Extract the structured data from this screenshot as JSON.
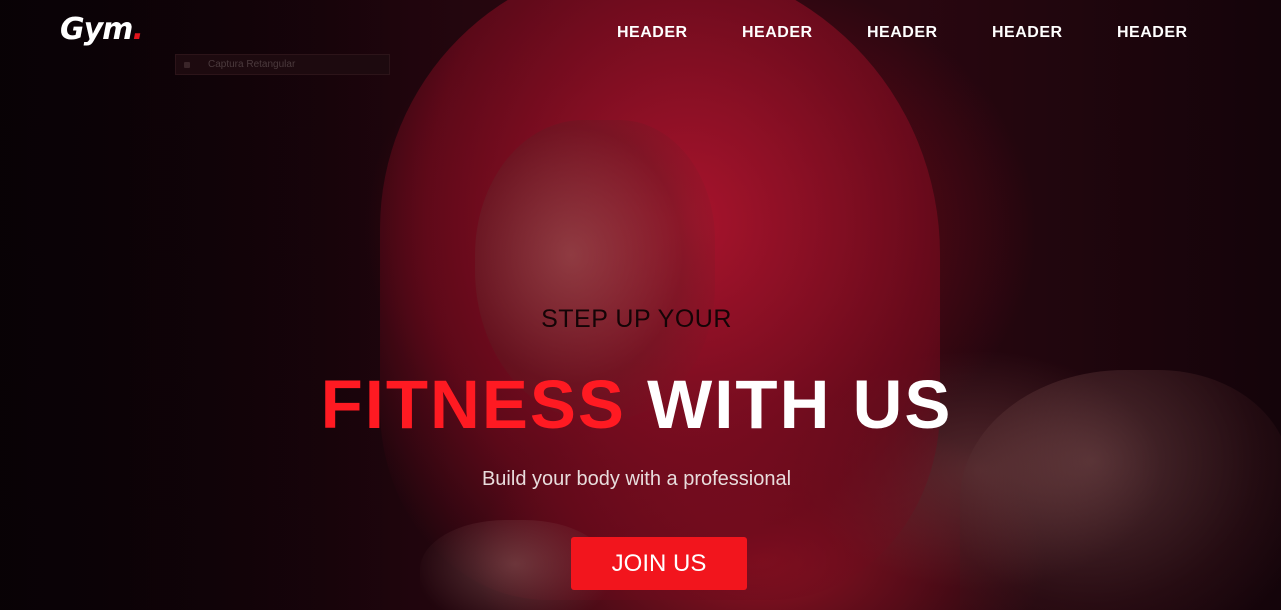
{
  "brand": {
    "name": "Gym",
    "dot": "."
  },
  "capture_chip": {
    "label": "Captura Retangular"
  },
  "nav": {
    "items": [
      {
        "label": "HEADER"
      },
      {
        "label": "HEADER"
      },
      {
        "label": "HEADER"
      },
      {
        "label": "HEADER"
      },
      {
        "label": "HEADER"
      }
    ]
  },
  "hero": {
    "pre_title": "STEP UP YOUR",
    "title_accent": "FITNESS",
    "title_rest": "WITH US",
    "subtitle": "Build your body with a professional",
    "cta_label": "JOIN US",
    "background_image": "hooded-boxer-photo"
  },
  "colors": {
    "accent": "#ff1a22",
    "button": "#f2151d",
    "text": "#ffffff",
    "background": "#120308"
  }
}
